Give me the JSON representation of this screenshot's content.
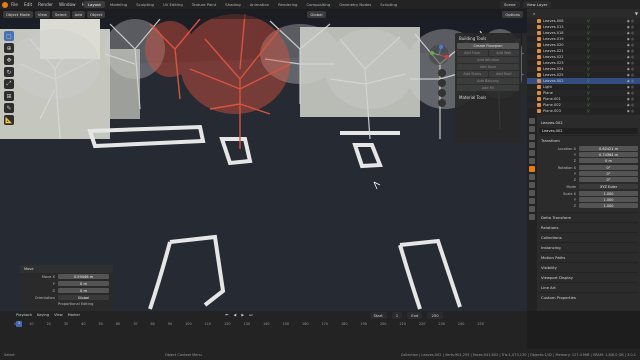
{
  "menu": [
    "File",
    "Edit",
    "Render",
    "Window",
    "Help"
  ],
  "workspaces": [
    "Layout",
    "Modeling",
    "Sculpting",
    "UV Editing",
    "Texture Paint",
    "Shading",
    "Animation",
    "Rendering",
    "Compositing",
    "Geometry Nodes",
    "Scripting"
  ],
  "active_workspace": "Layout",
  "scene": {
    "name": "Scene",
    "view_layer": "View Layer"
  },
  "viewport_header": {
    "mode": "Object Mode",
    "menus": [
      "View",
      "Select",
      "Add",
      "Object"
    ],
    "orientation": "Global",
    "options": "Options"
  },
  "n_panel": {
    "sections": [
      {
        "title": "Building Tools",
        "buttons": [
          [
            "Create Floorplan"
          ],
          [
            "Add Floor",
            "Add Wall"
          ],
          [
            "Add Window"
          ],
          [
            "Add Door"
          ],
          [
            "Add Stairs",
            "Add Roof"
          ],
          [
            "Add Balcony"
          ],
          [
            "Add Fill"
          ]
        ]
      },
      {
        "title": "Material Tools"
      }
    ]
  },
  "move_panel": {
    "title": "Move",
    "rows": [
      {
        "label": "Move X",
        "value": "0.59446 m"
      },
      {
        "label": "Y",
        "value": "0 m"
      },
      {
        "label": "Z",
        "value": "0 m"
      }
    ],
    "orientation_label": "Orientation",
    "orientation_value": "Global",
    "proportional": "Proportional Editing"
  },
  "outliner": {
    "items": [
      {
        "name": "Leaves.008"
      },
      {
        "name": "Leaves.013"
      },
      {
        "name": "Leaves.018"
      },
      {
        "name": "Leaves.019"
      },
      {
        "name": "Leaves.020"
      },
      {
        "name": "Leaves.021"
      },
      {
        "name": "Leaves.022"
      },
      {
        "name": "Leaves.023"
      },
      {
        "name": "Leaves.024"
      },
      {
        "name": "Leaves.025"
      },
      {
        "name": "Leaves.002",
        "selected": true
      },
      {
        "name": "Light"
      },
      {
        "name": "Plane"
      },
      {
        "name": "Plane.001"
      },
      {
        "name": "Plane.002"
      },
      {
        "name": "Plane.003"
      },
      {
        "name": "Plane.004"
      }
    ]
  },
  "properties": {
    "object_name": "Leaves.002",
    "data_name": "Leaves.002",
    "transform_title": "Transform",
    "location": [
      {
        "label": "Location X",
        "value": "0.62421 m"
      },
      {
        "label": "Y",
        "value": "0.74364 m"
      },
      {
        "label": "Z",
        "value": "0 m"
      }
    ],
    "rotation": [
      {
        "label": "Rotation X",
        "value": "0°"
      },
      {
        "label": "Y",
        "value": "0°"
      },
      {
        "label": "Z",
        "value": "0°"
      }
    ],
    "mode": {
      "label": "Mode",
      "value": "XYZ Euler"
    },
    "scale": [
      {
        "label": "Scale X",
        "value": "1.000"
      },
      {
        "label": "Y",
        "value": "1.000"
      },
      {
        "label": "Z",
        "value": "1.000"
      }
    ],
    "collapsed_sections": [
      "Delta Transform",
      "Relations",
      "Collections",
      "Instancing",
      "Motion Paths",
      "Visibility",
      "Viewport Display",
      "Line Art",
      "Custom Properties"
    ]
  },
  "timeline": {
    "menus": [
      "Playback",
      "Keying",
      "View",
      "Marker"
    ],
    "start_label": "Start",
    "start": "1",
    "end_label": "End",
    "end": "250",
    "current_frame": "1",
    "ticks": [
      "0",
      "10",
      "20",
      "30",
      "40",
      "50",
      "60",
      "70",
      "80",
      "90",
      "100",
      "110",
      "120",
      "130",
      "140",
      "150",
      "160",
      "170",
      "180",
      "190",
      "200",
      "210",
      "220",
      "230",
      "240",
      "250"
    ]
  },
  "statusbar": {
    "left": "Select",
    "middle": "Object Context Menu",
    "right": "Collection | Leaves.002 | Verts:904,255 | Faces:541,602 | Tris:1,073,130 | Objects:1/42 | Memory: 127.4 MiB | VRAM: 1.8/8.0 GB | 3.0.1"
  },
  "colors": {
    "accent": "#e87d0d",
    "select_blue": "#4772b3",
    "selected_tree": "#d9533f",
    "lines": "#e6e6e6"
  }
}
